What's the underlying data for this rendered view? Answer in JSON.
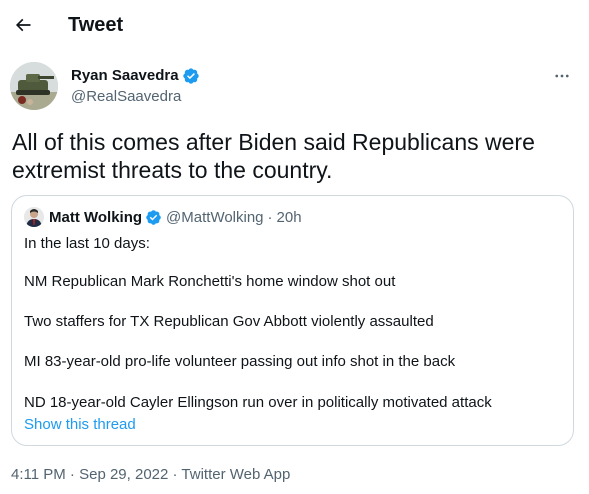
{
  "header": {
    "title": "Tweet"
  },
  "author": {
    "display_name": "Ryan Saavedra",
    "handle": "@RealSaavedra"
  },
  "tweet": {
    "text": "All of this comes after Biden said Republicans were extremist threats to the country."
  },
  "quote": {
    "display_name": "Matt Wolking",
    "handle": "@MattWolking",
    "separator": "·",
    "time": "20h",
    "lines": [
      "In the last 10 days:",
      "NM Republican Mark Ronchetti's home window shot out",
      "Two staffers for TX Republican Gov Abbott violently assaulted",
      "MI 83-year-old pro-life volunteer passing out info shot in the back",
      "ND 18-year-old Cayler Ellingson run over in politically motivated attack"
    ],
    "show_thread": "Show this thread"
  },
  "meta": {
    "time": "4:11 PM",
    "sep1": " · ",
    "date": "Sep 29, 2022",
    "sep2": " · ",
    "source": "Twitter Web App"
  },
  "icons": {
    "back": "arrow-left-icon",
    "verified": "verified-badge-icon",
    "more": "more-horizontal-icon"
  },
  "colors": {
    "accent": "#1d9bf0",
    "text": "#0f1419",
    "secondary": "#536471",
    "border": "#cfd9de"
  }
}
